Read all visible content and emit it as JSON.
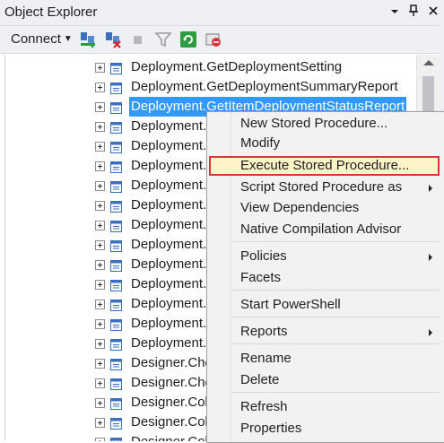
{
  "window": {
    "title": "Object Explorer",
    "title_icons": [
      "dropdown-icon",
      "pin-icon",
      "close-icon"
    ]
  },
  "toolbar": {
    "connect_label": "Connect",
    "buttons": [
      "connect-object-explorer-icon",
      "disconnect-icon",
      "stop-icon",
      "filter-icon",
      "refresh-icon",
      "activity-monitor-icon"
    ]
  },
  "tree": {
    "selected_index": 2,
    "items": [
      "Deployment.GetDeploymentSetting",
      "Deployment.GetDeploymentSummaryReport",
      "Deployment.GetItemDeploymentStatusReport",
      "Deployment.G",
      "Deployment.G",
      "Deployment.G",
      "Deployment.G",
      "Deployment.S",
      "Deployment.U",
      "Deployment.U",
      "Deployment.U",
      "Deployment.V",
      "Deployment.V",
      "Deployment.V",
      "Deployment.V",
      "Designer.Che",
      "Designer.Che",
      "Designer.Coll",
      "Designer.Coll",
      "Designer.Coll"
    ]
  },
  "context_menu": {
    "items": [
      {
        "label": "New Stored Procedure...",
        "submenu": false
      },
      {
        "label": "Modify",
        "submenu": false
      },
      {
        "label": "Execute Stored Procedure...",
        "submenu": false,
        "highlighted": true
      },
      {
        "label": "Script Stored Procedure as",
        "submenu": true
      },
      {
        "label": "View Dependencies",
        "submenu": false
      },
      {
        "label": "Native Compilation Advisor",
        "submenu": false
      },
      {
        "label": "Policies",
        "submenu": true
      },
      {
        "label": "Facets",
        "submenu": false
      },
      {
        "label": "Start PowerShell",
        "submenu": false
      },
      {
        "label": "Reports",
        "submenu": true
      },
      {
        "label": "Rename",
        "submenu": false
      },
      {
        "label": "Delete",
        "submenu": false
      },
      {
        "label": "Refresh",
        "submenu": false
      },
      {
        "label": "Properties",
        "submenu": false
      }
    ]
  },
  "colors": {
    "selection": "#3399ff",
    "highlight_border": "#e0343c",
    "highlight_fill": "#fff3c8"
  }
}
